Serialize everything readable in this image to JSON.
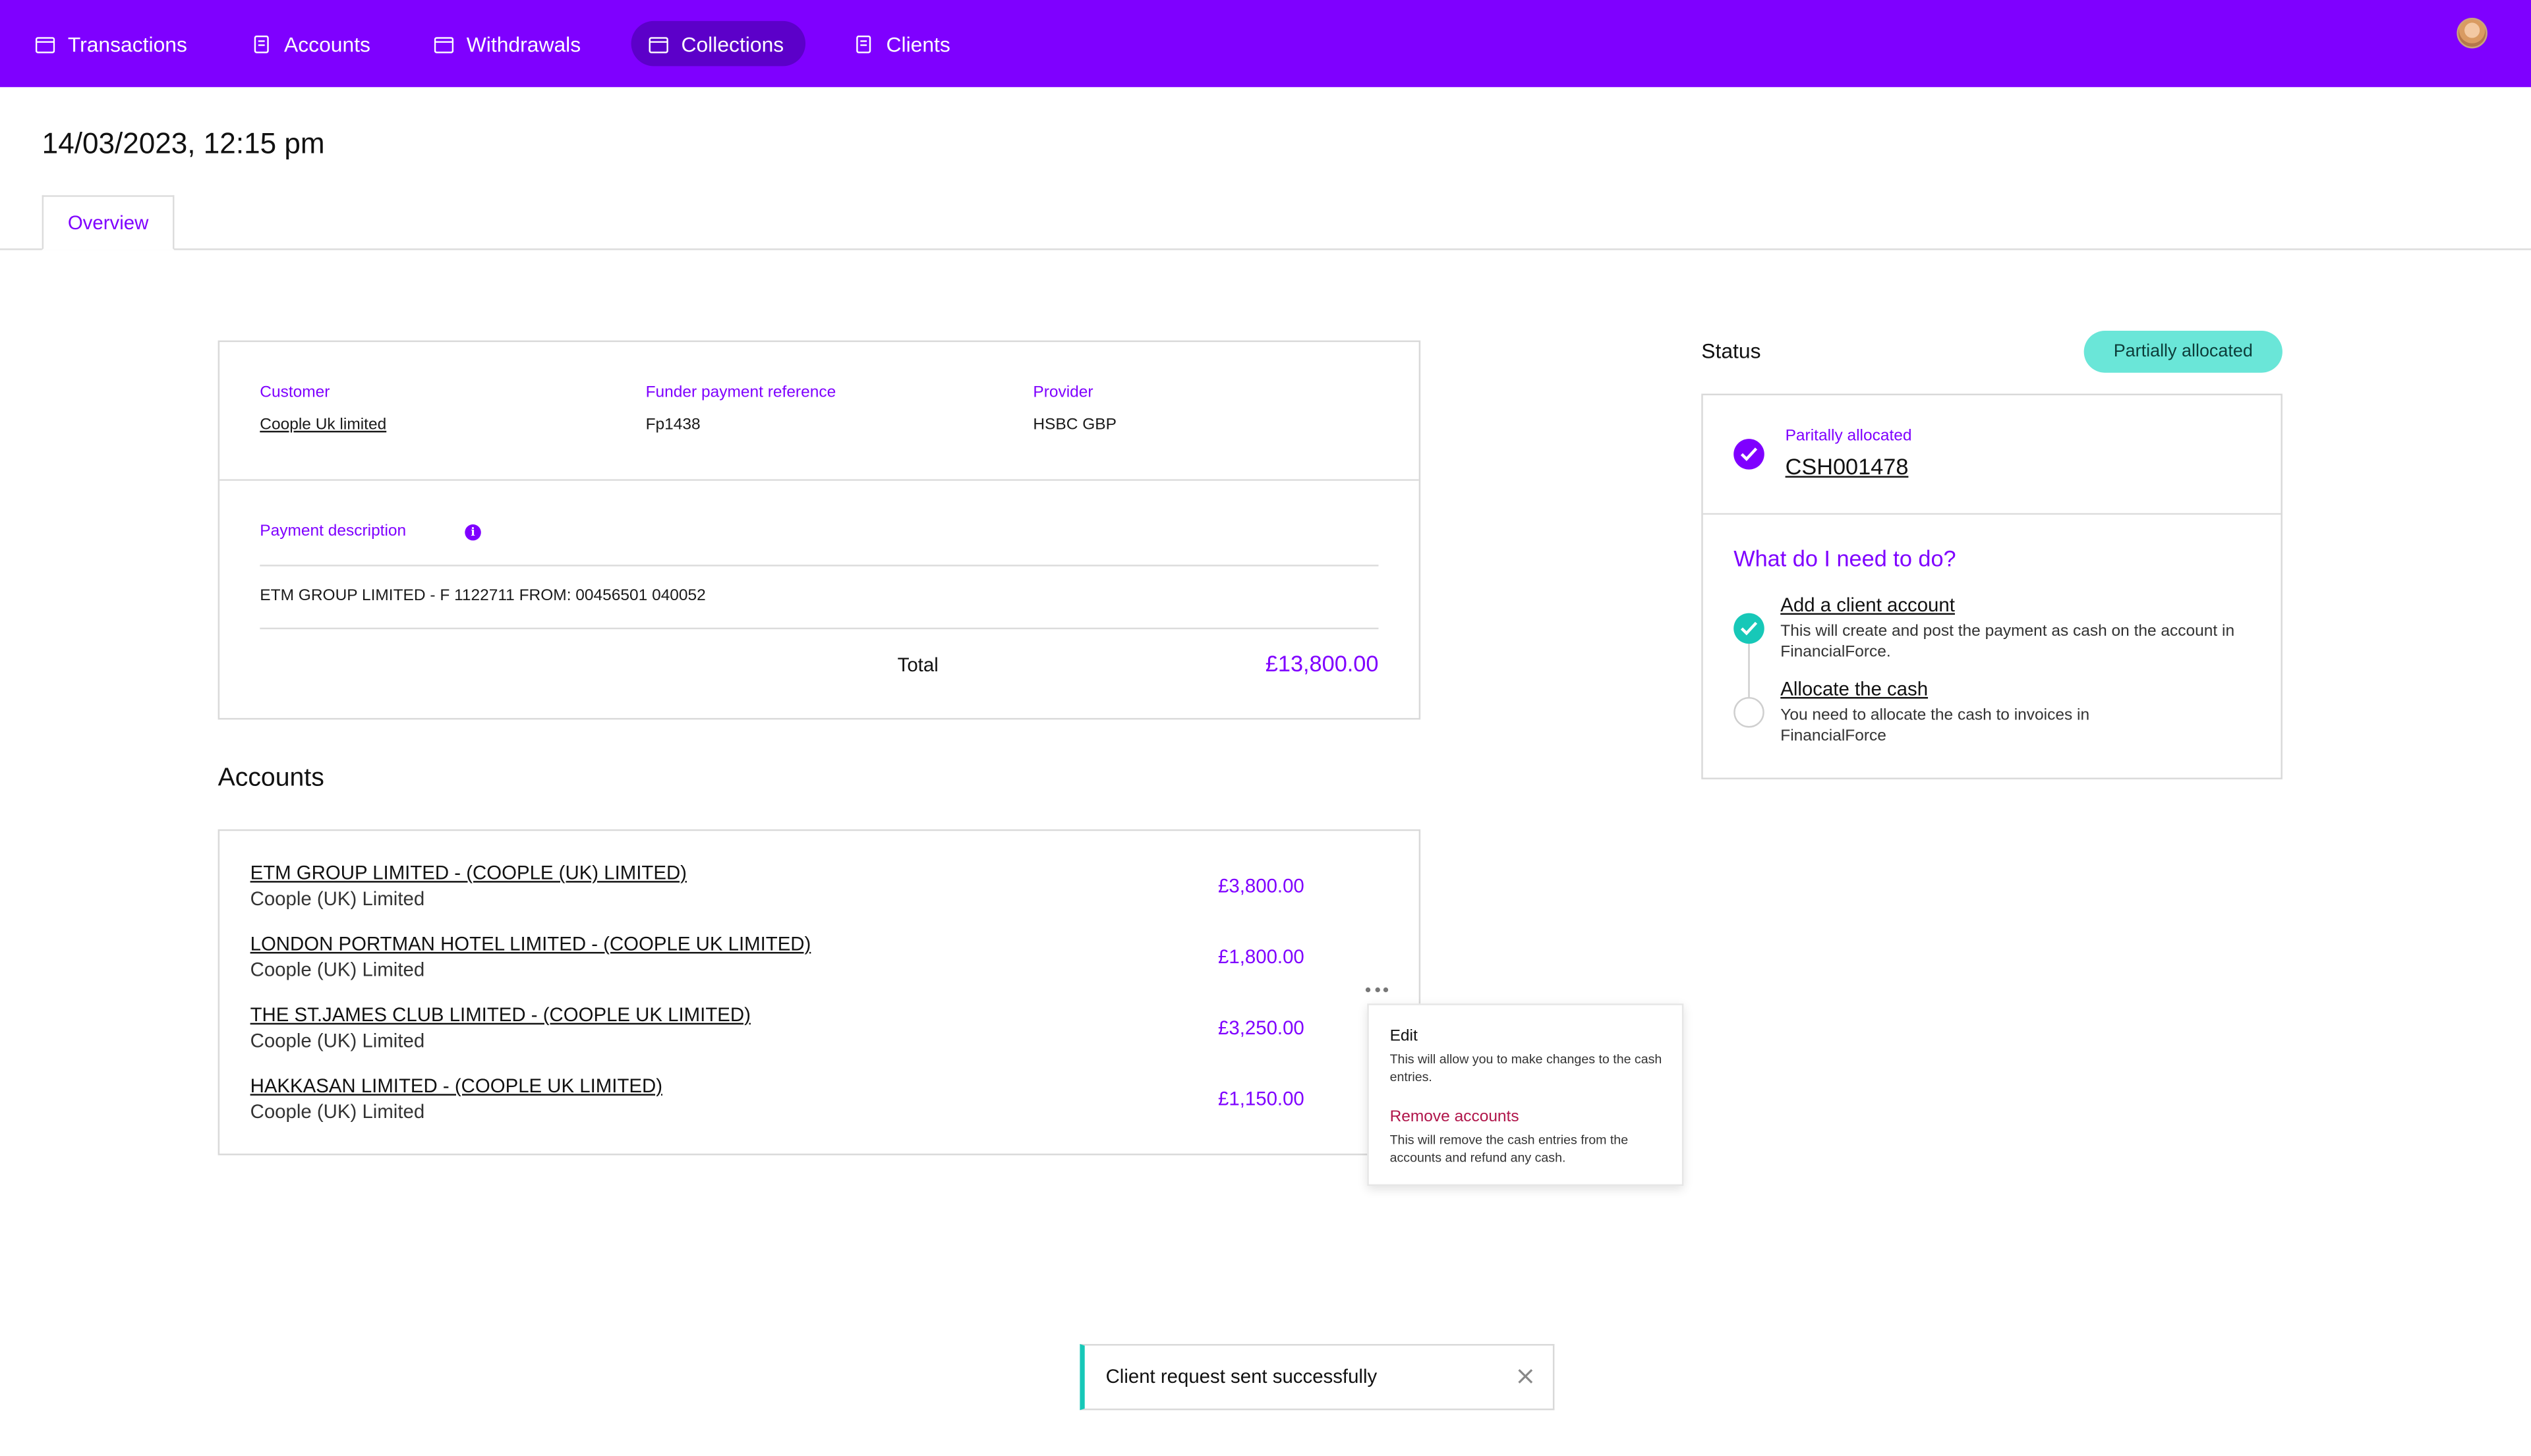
{
  "nav": {
    "items": [
      {
        "label": "Transactions",
        "icon": "wallet-icon"
      },
      {
        "label": "Accounts",
        "icon": "receipt-icon"
      },
      {
        "label": "Withdrawals",
        "icon": "wallet-icon"
      },
      {
        "label": "Collections",
        "icon": "wallet-icon",
        "active": true
      },
      {
        "label": "Clients",
        "icon": "receipt-icon"
      }
    ],
    "avatar_icon": "user-avatar"
  },
  "page": {
    "title": "14/03/2023, 12:15 pm",
    "tab_overview": "Overview"
  },
  "payment": {
    "customer_label": "Customer",
    "customer_value": "Coople Uk limited",
    "funder_ref_label": "Funder payment reference",
    "funder_ref_value": "Fp1438",
    "provider_label": "Provider",
    "provider_value": "HSBC GBP",
    "description_label": "Payment description",
    "description_value": "ETM GROUP LIMITED - F 1122711 FROM: 00456501 040052",
    "total_label": "Total",
    "total_value": "£13,800.00"
  },
  "accounts": {
    "title": "Accounts",
    "rows": [
      {
        "name": "ETM GROUP LIMITED - (COOPLE (UK) LIMITED)",
        "sub": "Coople (UK) Limited",
        "amount": "£3,800.00"
      },
      {
        "name": "LONDON PORTMAN HOTEL LIMITED - (COOPLE UK LIMITED)",
        "sub": "Coople (UK) Limited",
        "amount": "£1,800.00"
      },
      {
        "name": "THE ST.JAMES CLUB LIMITED - (COOPLE UK LIMITED)",
        "sub": "Coople (UK) Limited",
        "amount": "£3,250.00"
      },
      {
        "name": "HAKKASAN LIMITED - (COOPLE UK LIMITED)",
        "sub": "Coople (UK) Limited",
        "amount": "£1,150.00"
      }
    ]
  },
  "menu": {
    "edit_title": "Edit",
    "edit_desc": "This will allow you to make changes to the cash entries.",
    "remove_title": "Remove accounts",
    "remove_desc": "This will remove the cash entries from the accounts and refund any cash."
  },
  "status": {
    "label": "Status",
    "badge": "Partially allocated",
    "alloc_label": "Paritally allocated",
    "alloc_ref": "CSH001478",
    "todo_heading": "What do I need to do?",
    "steps": [
      {
        "title": "Add a client account",
        "desc": "This will create and post the payment as cash on the account in FinancialForce.",
        "done": true
      },
      {
        "title": "Allocate the cash",
        "desc": "You need to allocate the cash to invoices in FinancialForce",
        "done": false
      }
    ]
  },
  "toast": {
    "message": "Client request sent successfully"
  },
  "colors": {
    "brand": "#7f00ff",
    "nav_active": "#5c00c9",
    "badge": "#6ae6d8",
    "success": "#17c8b8",
    "danger": "#b0154a"
  }
}
